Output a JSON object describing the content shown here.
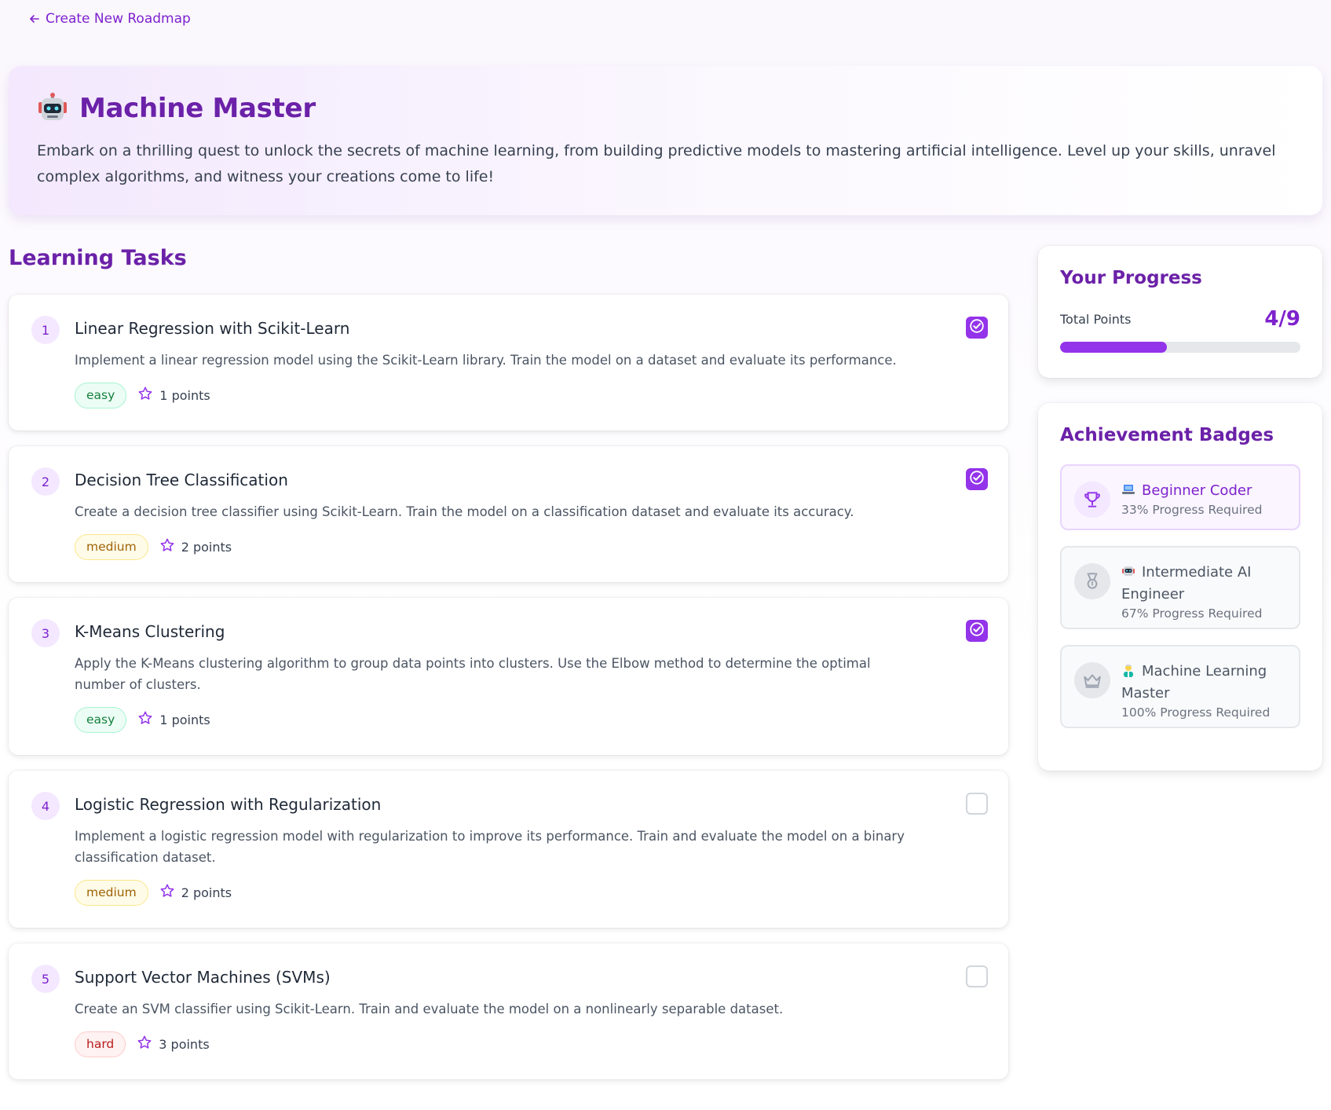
{
  "nav": {
    "back_label": "Create New Roadmap"
  },
  "hero": {
    "title": "Machine Master",
    "description": "Embark on a thrilling quest to unlock the secrets of machine learning, from building predictive models to mastering artificial intelligence. Level up your skills, unravel complex algorithms, and witness your creations come to life!",
    "emoji_icon": "robot-face-icon"
  },
  "tasks_section": {
    "title": "Learning Tasks",
    "tasks": [
      {
        "number": "1",
        "title": "Linear Regression with Scikit-Learn",
        "description": "Implement a linear regression model using the Scikit-Learn library. Train the model on a dataset and evaluate its performance.",
        "difficulty": "easy",
        "points": "1 points",
        "completed": true
      },
      {
        "number": "2",
        "title": "Decision Tree Classification",
        "description": "Create a decision tree classifier using Scikit-Learn. Train the model on a classification dataset and evaluate its accuracy.",
        "difficulty": "medium",
        "points": "2 points",
        "completed": true
      },
      {
        "number": "3",
        "title": "K-Means Clustering",
        "description": "Apply the K-Means clustering algorithm to group data points into clusters. Use the Elbow method to determine the optimal number of clusters.",
        "difficulty": "easy",
        "points": "1 points",
        "completed": true
      },
      {
        "number": "4",
        "title": "Logistic Regression with Regularization",
        "description": "Implement a logistic regression model with regularization to improve its performance. Train and evaluate the model on a binary classification dataset.",
        "difficulty": "medium",
        "points": "2 points",
        "completed": false
      },
      {
        "number": "5",
        "title": "Support Vector Machines (SVMs)",
        "description": "Create an SVM classifier using Scikit-Learn. Train and evaluate the model on a nonlinearly separable dataset.",
        "difficulty": "hard",
        "points": "3 points",
        "completed": false
      }
    ]
  },
  "progress": {
    "title": "Your Progress",
    "points_label": "Total Points",
    "points_value": "4/9",
    "fraction": 0.444
  },
  "achievements": {
    "title": "Achievement Badges",
    "items": [
      {
        "name": "Beginner Coder",
        "emoji_icon": "laptop-icon",
        "requirement": "33% Progress Required",
        "icon": "trophy-icon",
        "unlocked": true
      },
      {
        "name": "Intermediate AI Engineer",
        "emoji_icon": "robot-face-icon",
        "requirement": "67% Progress Required",
        "icon": "medal-icon",
        "unlocked": false
      },
      {
        "name": "Machine Learning Master",
        "emoji_icon": "scientist-icon",
        "requirement": "100% Progress Required",
        "icon": "crown-icon",
        "unlocked": false
      }
    ]
  },
  "colors": {
    "accent": "#7e22ce",
    "accent_light": "#f3e8ff",
    "easy": "#15803d",
    "medium": "#a16207",
    "hard": "#b91c1c"
  }
}
